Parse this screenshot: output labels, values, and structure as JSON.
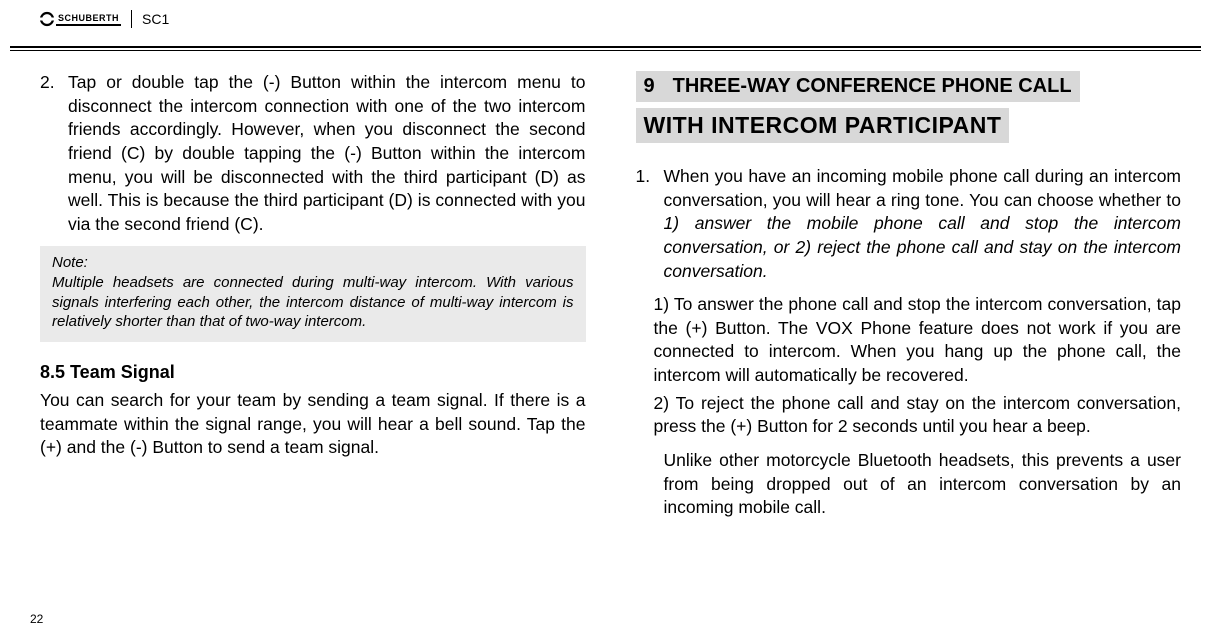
{
  "header": {
    "brand": "SCHUBERTH",
    "model": "SC1"
  },
  "left": {
    "item2_num": "2.",
    "item2_text": "Tap or double tap the (-) Button within the intercom menu to disconnect the intercom connection with one of the two intercom friends accordingly. However, when you disconnect the second friend (C) by double tapping the (-) Button within the intercom menu, you will be disconnected with the third participant (D) as well. This is because the third participant (D) is connected with you via the second friend (C).",
    "note_title": "Note:",
    "note_body": "Multiple headsets are connected during multi-way intercom. With various signals interfering each other, the intercom distance of multi-way intercom is relatively shorter than that of two-way intercom.",
    "subheading": "8.5  Team Signal",
    "sub_body": "You can search for your team by sending a team signal. If there is a teammate within the signal range, you will hear a bell sound. Tap the (+) and the (-) Button to send a team signal."
  },
  "right": {
    "chapter_num": "9",
    "title_line1": "THREE-WAY CONFERENCE PHONE CALL",
    "title_line2": "WITH INTERCOM PARTICIPANT",
    "item1_num": "1.",
    "item1_lead": "When you have an incoming mobile phone call during an intercom conversation, you will hear a ring tone. You can choose whether to ",
    "item1_italic": "1) answer the mobile phone call and stop the intercom conversation, or 2) reject the phone call and stay on the intercom conversation.",
    "sub1": "1) To answer the phone call and stop the intercom conversation, tap the (+) Button. The VOX Phone feature does not work if you are connected to intercom. When you hang up the phone call, the intercom will automatically be recovered.",
    "sub2": "2) To reject the phone call and stay on the intercom conversation, press the (+) Button for 2 seconds until you hear a beep.",
    "follow": "Unlike other motorcycle Bluetooth headsets, this prevents a user from being dropped out of an intercom conversation by an incoming mobile call."
  },
  "page_number": "22"
}
